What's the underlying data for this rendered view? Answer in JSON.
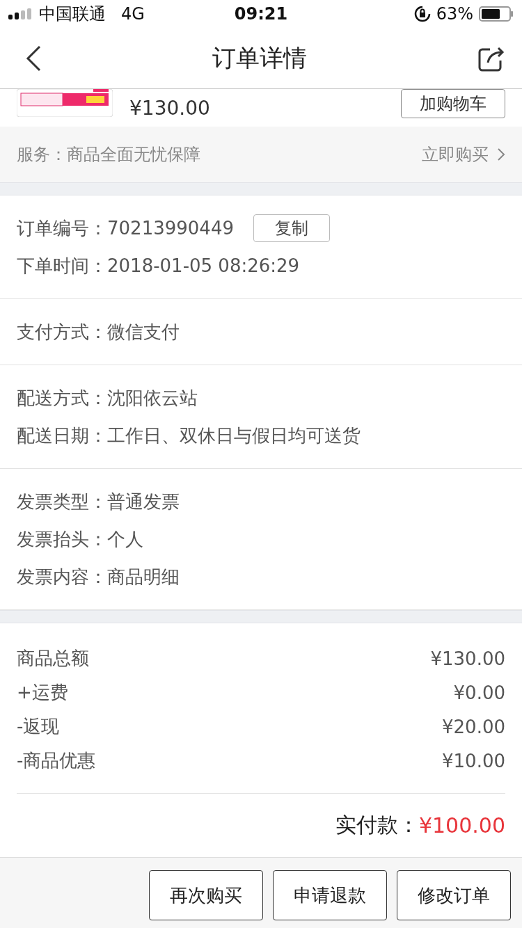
{
  "status_bar": {
    "carrier": "中国联通",
    "network": "4G",
    "time": "09:21",
    "battery": "63%"
  },
  "nav": {
    "title": "订单详情"
  },
  "product": {
    "price": "¥130.00",
    "button": "加购物车"
  },
  "service": {
    "text": "服务：商品全面无忧保障",
    "action": "立即购买"
  },
  "sections": [
    {
      "rows": [
        {
          "label": "订单编号：",
          "value": "70213990449",
          "button": "复制"
        },
        {
          "label": "下单时间：",
          "value": "2018-01-05 08:26:29"
        }
      ]
    },
    {
      "rows": [
        {
          "label": "支付方式：",
          "value": "微信支付"
        }
      ]
    },
    {
      "rows": [
        {
          "label": "配送方式：",
          "value": "沈阳依云站"
        },
        {
          "label": "配送日期：",
          "value": "工作日、双休日与假日均可送货"
        }
      ]
    },
    {
      "rows": [
        {
          "label": "发票类型：",
          "value": "普通发票"
        },
        {
          "label": "发票抬头：",
          "value": "个人"
        },
        {
          "label": "发票内容：",
          "value": "商品明细"
        }
      ]
    }
  ],
  "summary": {
    "items": [
      {
        "label": "商品总额",
        "amount": "¥130.00"
      },
      {
        "label": "+运费",
        "amount": "¥0.00"
      },
      {
        "label": "-返现",
        "amount": "¥20.00"
      },
      {
        "label": "-商品优惠",
        "amount": "¥10.00"
      }
    ],
    "total_label": "实付款：",
    "total": "¥100.00"
  },
  "actions": [
    "再次购买",
    "申请退款",
    "修改订单"
  ]
}
